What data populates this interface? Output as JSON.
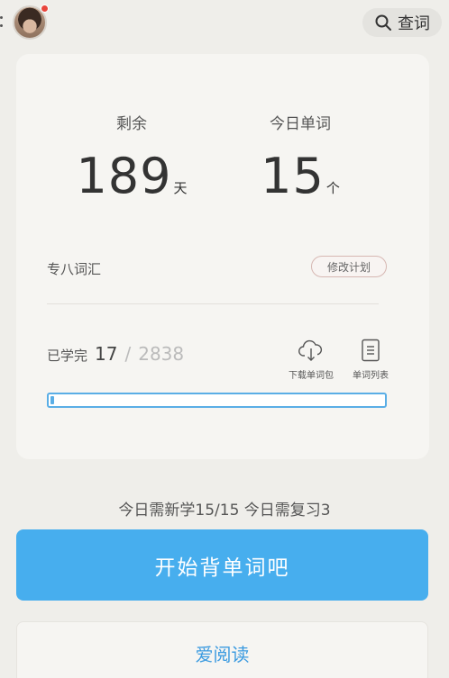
{
  "header": {
    "search_label": "查词",
    "avatar_notification": true
  },
  "stats": {
    "remaining_caption": "剩余",
    "remaining_value": "189",
    "remaining_unit": "天",
    "today_caption": "今日单词",
    "today_value": "15",
    "today_unit": "个"
  },
  "plan": {
    "book_name": "专八词汇",
    "edit_label": "修改计划"
  },
  "progress": {
    "learned_label": "已学完",
    "learned_count": "17",
    "separator": "/",
    "total_count": "2838",
    "fraction": 0.006
  },
  "tools": {
    "download_label": "下载单词包",
    "list_label": "单词列表"
  },
  "summary": {
    "today_text": "今日需新学15/15  今日需复习3"
  },
  "actions": {
    "start_label": "开始背单词吧",
    "read_label": "爱阅读"
  },
  "colors": {
    "accent": "#47aeee",
    "link": "#3c9be0",
    "background": "#efeeea",
    "card": "#f6f5f2",
    "notification": "#e8453c"
  }
}
